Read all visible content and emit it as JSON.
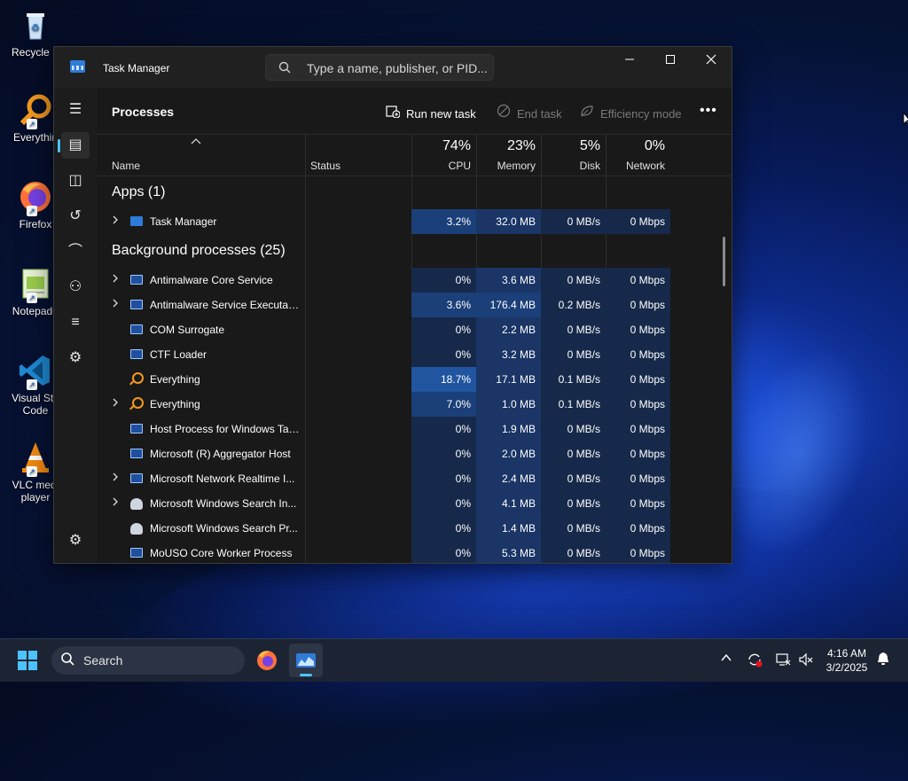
{
  "desktop": {
    "icons": [
      {
        "label": "Recycle B",
        "icon": "recycle-bin-icon"
      },
      {
        "label": "Everythin",
        "icon": "everything-icon"
      },
      {
        "label": "Firefox",
        "icon": "firefox-icon"
      },
      {
        "label": "Notepad+",
        "icon": "notepad-plus-plus-icon"
      },
      {
        "label": "Visual Stu",
        "label2": "Code",
        "icon": "vscode-icon"
      },
      {
        "label": "VLC medi",
        "label2": "player",
        "icon": "vlc-icon"
      }
    ]
  },
  "window": {
    "title": "Task Manager",
    "search_placeholder": "Type a name, publisher, or PID...",
    "controls": {
      "minimize": "—",
      "maximize": "☐",
      "close": "✕"
    }
  },
  "nav": {
    "hamburger": "☰",
    "items": [
      {
        "name": "processes",
        "glyph": "▤",
        "active": true
      },
      {
        "name": "performance",
        "glyph": "◫"
      },
      {
        "name": "app-history",
        "glyph": "↺"
      },
      {
        "name": "startup-apps",
        "glyph": "⌒"
      },
      {
        "name": "users",
        "glyph": "⚇"
      },
      {
        "name": "details",
        "glyph": "≡"
      },
      {
        "name": "services",
        "glyph": "⚙"
      }
    ],
    "settings": "⚙"
  },
  "toolbar": {
    "page_title": "Processes",
    "run_new_task": "Run new task",
    "end_task": "End task",
    "efficiency_mode": "Efficiency mode",
    "more": "•••"
  },
  "columns": {
    "name": "Name",
    "status": "Status",
    "cpu": {
      "pct": "74%",
      "label": "CPU"
    },
    "memory": {
      "pct": "23%",
      "label": "Memory"
    },
    "disk": {
      "pct": "5%",
      "label": "Disk"
    },
    "network": {
      "pct": "0%",
      "label": "Network"
    }
  },
  "groups": {
    "apps": "Apps (1)",
    "background": "Background processes (25)"
  },
  "apps": [
    {
      "name": "Task Manager",
      "expandable": true,
      "icon": "task-manager-icon",
      "cpu": "3.2%",
      "memory": "32.0 MB",
      "disk": "0 MB/s",
      "network": "0 Mbps",
      "heat": 2
    }
  ],
  "background": [
    {
      "name": "Antimalware Core Service",
      "expandable": true,
      "icon": "window-icon",
      "cpu": "0%",
      "memory": "3.6 MB",
      "disk": "0 MB/s",
      "network": "0 Mbps",
      "heat": 0
    },
    {
      "name": "Antimalware Service Executable",
      "expandable": true,
      "icon": "window-icon",
      "cpu": "3.6%",
      "memory": "176.4 MB",
      "disk": "0.2 MB/s",
      "network": "0 Mbps",
      "heat": 2
    },
    {
      "name": "COM Surrogate",
      "expandable": false,
      "icon": "window-icon",
      "cpu": "0%",
      "memory": "2.2 MB",
      "disk": "0 MB/s",
      "network": "0 Mbps",
      "heat": 0
    },
    {
      "name": "CTF Loader",
      "expandable": false,
      "icon": "window-icon",
      "cpu": "0%",
      "memory": "3.2 MB",
      "disk": "0 MB/s",
      "network": "0 Mbps",
      "heat": 0
    },
    {
      "name": "Everything",
      "expandable": false,
      "icon": "everything-icon",
      "cpu": "18.7%",
      "memory": "17.1 MB",
      "disk": "0.1 MB/s",
      "network": "0 Mbps",
      "heat": 3
    },
    {
      "name": "Everything",
      "expandable": true,
      "icon": "everything-icon",
      "cpu": "7.0%",
      "memory": "1.0 MB",
      "disk": "0.1 MB/s",
      "network": "0 Mbps",
      "heat": 2
    },
    {
      "name": "Host Process for Windows Tasks",
      "expandable": false,
      "icon": "window-icon",
      "cpu": "0%",
      "memory": "1.9 MB",
      "disk": "0 MB/s",
      "network": "0 Mbps",
      "heat": 0
    },
    {
      "name": "Microsoft (R) Aggregator Host",
      "expandable": false,
      "icon": "window-icon",
      "cpu": "0%",
      "memory": "2.0 MB",
      "disk": "0 MB/s",
      "network": "0 Mbps",
      "heat": 0
    },
    {
      "name": "Microsoft Network Realtime I...",
      "expandable": true,
      "icon": "window-icon",
      "cpu": "0%",
      "memory": "2.4 MB",
      "disk": "0 MB/s",
      "network": "0 Mbps",
      "heat": 0
    },
    {
      "name": "Microsoft Windows Search In...",
      "expandable": true,
      "icon": "search-indexer-icon",
      "cpu": "0%",
      "memory": "4.1 MB",
      "disk": "0 MB/s",
      "network": "0 Mbps",
      "heat": 0
    },
    {
      "name": "Microsoft Windows Search Pr...",
      "expandable": false,
      "icon": "search-indexer-icon",
      "cpu": "0%",
      "memory": "1.4 MB",
      "disk": "0 MB/s",
      "network": "0 Mbps",
      "heat": 0
    },
    {
      "name": "MoUSO Core Worker Process",
      "expandable": false,
      "icon": "window-icon",
      "cpu": "0%",
      "memory": "5.3 MB",
      "disk": "0 MB/s",
      "network": "0 Mbps",
      "heat": 0
    }
  ],
  "heat_colors": {
    "base": "#152a4d",
    "0": "#16294a",
    "2": "#1b3f78",
    "3": "#2155a0",
    "mem": "#1a3566"
  },
  "taskbar": {
    "search_label": "Search",
    "time": "4:16 AM",
    "date": "3/2/2025"
  },
  "colors": {
    "accent": "#4cc2ff",
    "window_bg": "#1c1c1c",
    "content_bg": "#191919"
  }
}
